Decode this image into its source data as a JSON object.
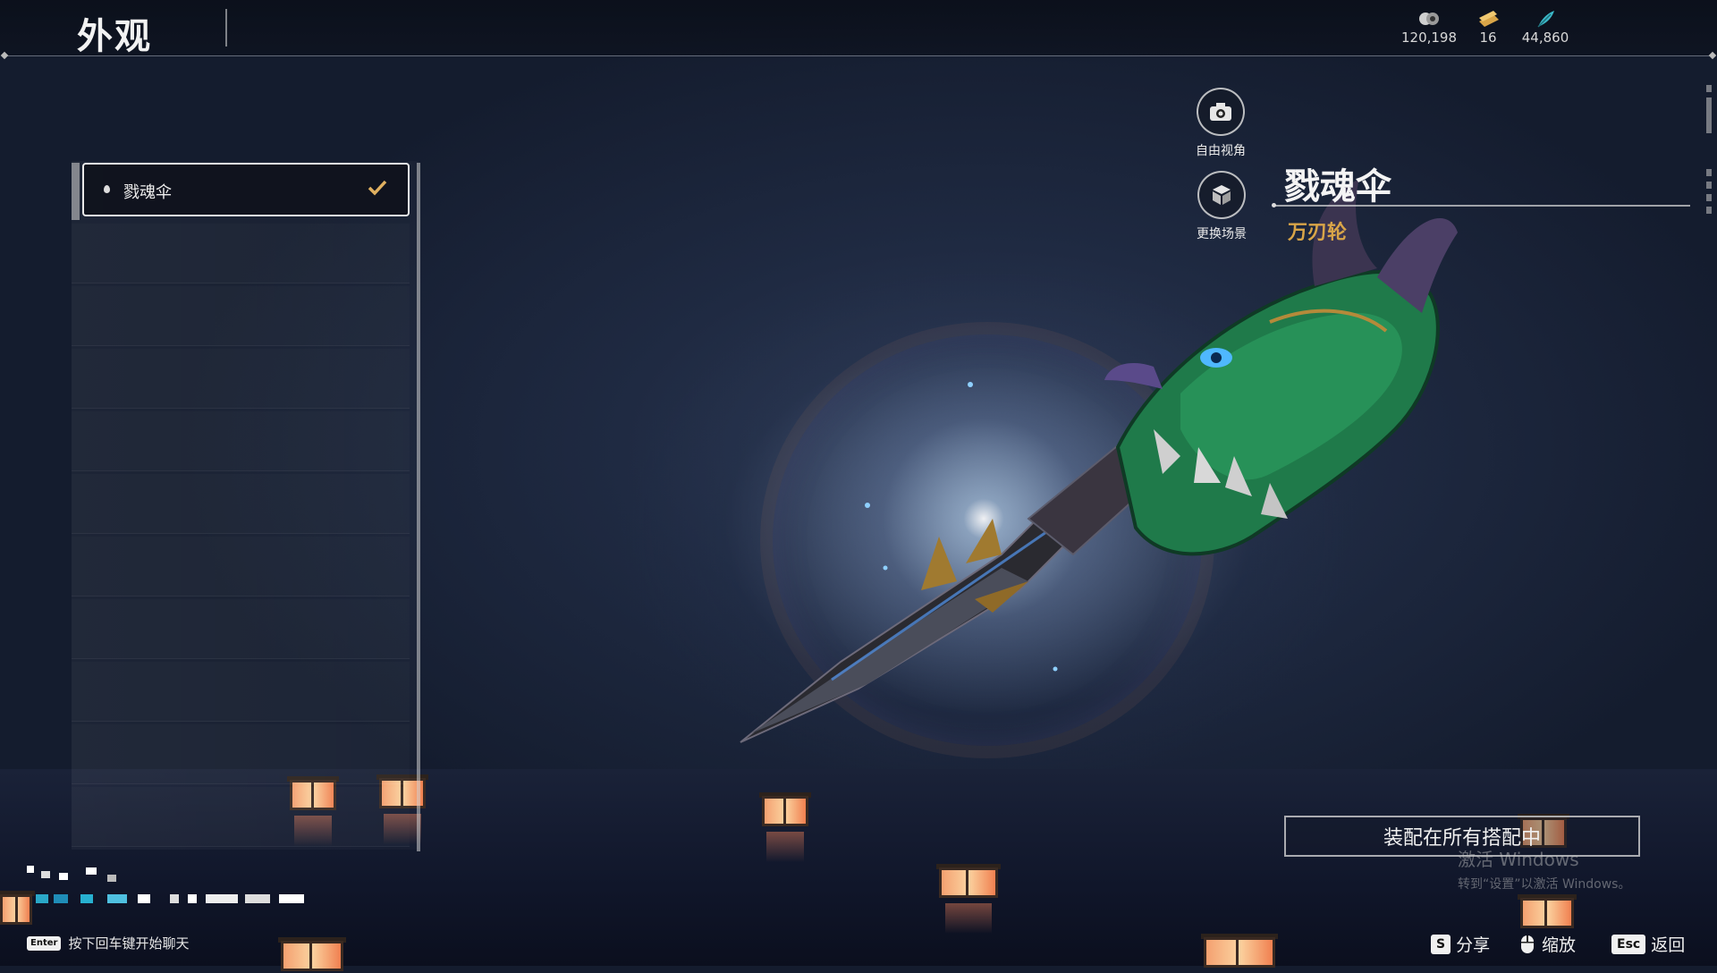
{
  "header": {
    "title": "外观",
    "currencies": [
      {
        "icon": "coin-icon",
        "value": "120,198"
      },
      {
        "icon": "ticket-icon",
        "value": "16"
      },
      {
        "icon": "feather-icon",
        "value": "44,860"
      }
    ]
  },
  "list": {
    "selected_item": {
      "label": "戮魂伞",
      "status_icon": "checkmark-icon"
    }
  },
  "controls": {
    "free_camera": "自由视角",
    "change_scene": "更换场景"
  },
  "item": {
    "name": "戮魂伞",
    "type": "万刃轮"
  },
  "actions": {
    "equip_all": "装配在所有搭配中"
  },
  "watermark": {
    "line1": "激活 Windows",
    "line2": "转到“设置”以激活 Windows。"
  },
  "footer": {
    "chat_key": "Enter",
    "chat_hint": "按下回车键开始聊天",
    "share_key": "S",
    "share_label": "分享",
    "zoom_label": "缩放",
    "back_key": "Esc",
    "back_label": "返回"
  },
  "colors": {
    "accent_gold": "#d9a548",
    "weapon_jade": "#1f7a4a"
  }
}
